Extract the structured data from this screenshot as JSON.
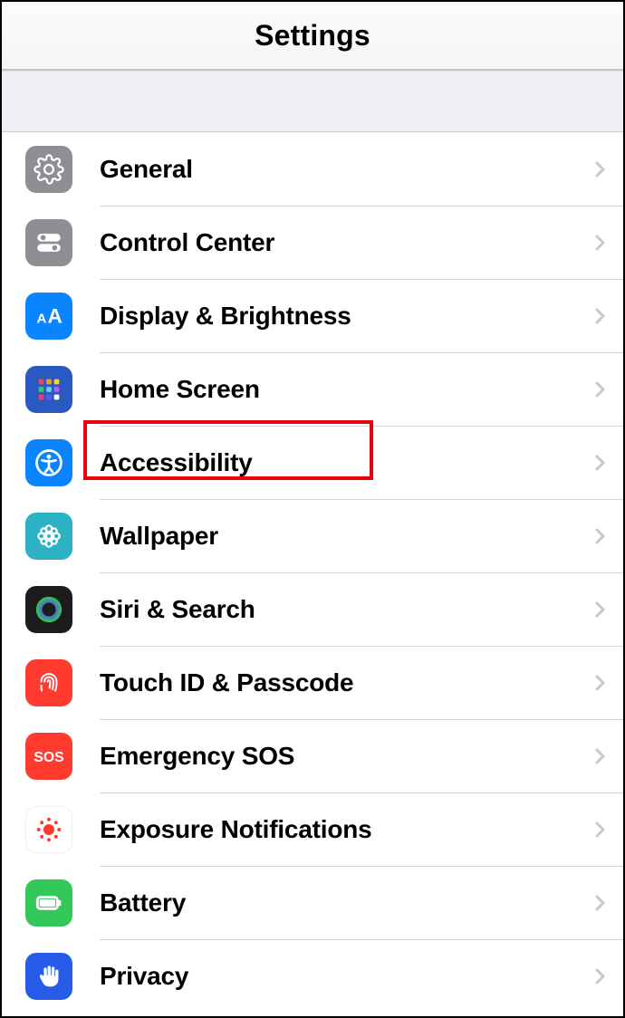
{
  "header": {
    "title": "Settings"
  },
  "rows": [
    {
      "id": "general",
      "label": "General"
    },
    {
      "id": "control-center",
      "label": "Control Center"
    },
    {
      "id": "display-brightness",
      "label": "Display & Brightness"
    },
    {
      "id": "home-screen",
      "label": "Home Screen"
    },
    {
      "id": "accessibility",
      "label": "Accessibility",
      "highlighted": true
    },
    {
      "id": "wallpaper",
      "label": "Wallpaper"
    },
    {
      "id": "siri-search",
      "label": "Siri & Search"
    },
    {
      "id": "touchid-passcode",
      "label": "Touch ID & Passcode"
    },
    {
      "id": "emergency-sos",
      "label": "Emergency SOS"
    },
    {
      "id": "exposure-notifications",
      "label": "Exposure Notifications"
    },
    {
      "id": "battery",
      "label": "Battery"
    },
    {
      "id": "privacy",
      "label": "Privacy"
    }
  ]
}
